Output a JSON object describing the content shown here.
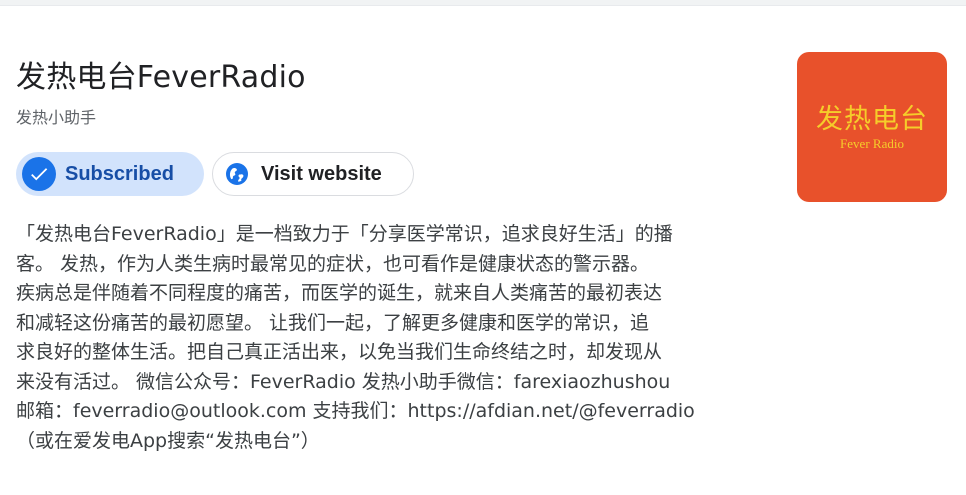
{
  "podcast": {
    "title": "发热电台FeverRadio",
    "author": "发热小助手",
    "artwork_title": "发热电台",
    "artwork_subtitle": "Fever Radio",
    "artwork_color": "#e8512b",
    "artwork_text_color": "#f5cd2a"
  },
  "actions": {
    "subscribed_label": "Subscribed",
    "subscribed_icon": "check-icon",
    "visit_label": "Visit website",
    "visit_icon": "globe-icon",
    "accent_color": "#1a73e8"
  },
  "description": {
    "lines": [
      "「发热电台FeverRadio」是一档致力于「分享医学常识，追求良好生活」的播",
      "客。 发热，作为人类生病时最常见的症状，也可看作是健康状态的警示器。",
      "疾病总是伴随着不同程度的痛苦，而医学的诞生，就来自人类痛苦的最初表达",
      "和减轻这份痛苦的最初愿望。 让我们一起，了解更多健康和医学的常识，追",
      "求良好的整体生活。把自己真正活出来，以免当我们生命终结之时，却发现从",
      "来没有活过。 微信公众号：FeverRadio 发热小助手微信：farexiaozhushou",
      "邮箱：feverradio@outlook.com 支持我们：https://afdian.net/@feverradio",
      "（或在爱发电App搜索“发热电台”）"
    ]
  }
}
